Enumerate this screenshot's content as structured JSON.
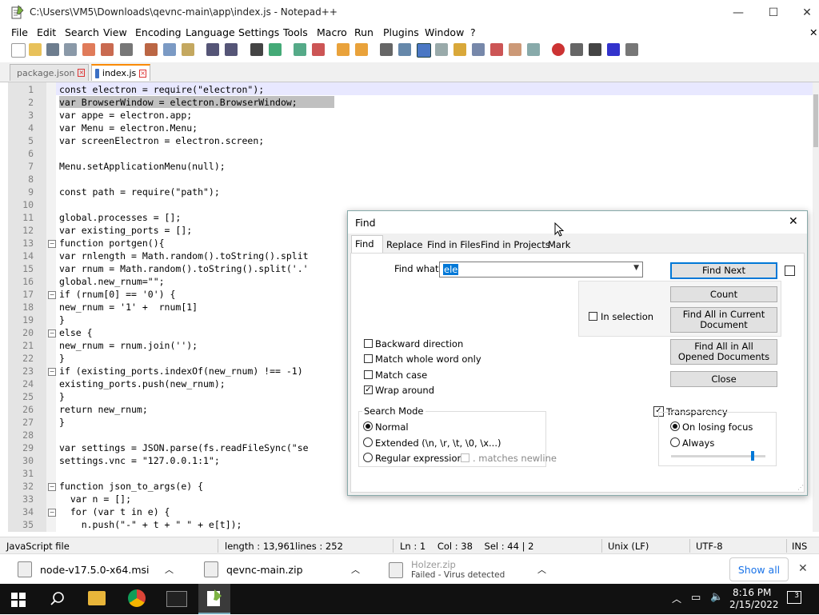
{
  "window": {
    "title": "C:\\Users\\VM5\\Downloads\\qevnc-main\\app\\index.js - Notepad++",
    "minimize": "—",
    "maximize": "☐",
    "close": "✕"
  },
  "menu": [
    "File",
    "Edit",
    "Search",
    "View",
    "Encoding",
    "Language",
    "Settings",
    "Tools",
    "Macro",
    "Run",
    "Plugins",
    "Window",
    "?"
  ],
  "menu_close": "✕",
  "tabs": [
    {
      "label": "package.json",
      "active": false
    },
    {
      "label": "index.js",
      "active": true
    }
  ],
  "editor": {
    "lines": [
      {
        "n": "1",
        "t": "const electron = require(\"electron\");"
      },
      {
        "n": "2",
        "t": "var BrowserWindow = electron.BrowserWindow;"
      },
      {
        "n": "3",
        "t": "var appe = electron.app;"
      },
      {
        "n": "4",
        "t": "var Menu = electron.Menu;"
      },
      {
        "n": "5",
        "t": "var screenElectron = electron.screen;"
      },
      {
        "n": "6",
        "t": ""
      },
      {
        "n": "7",
        "t": "Menu.setApplicationMenu(null);"
      },
      {
        "n": "8",
        "t": ""
      },
      {
        "n": "9",
        "t": "const path = require(\"path\");"
      },
      {
        "n": "10",
        "t": ""
      },
      {
        "n": "11",
        "t": "global.processes = [];"
      },
      {
        "n": "12",
        "t": "var existing_ports = [];"
      },
      {
        "n": "13",
        "t": "function portgen(){"
      },
      {
        "n": "14",
        "t": "var rnlength = Math.random().toString().split"
      },
      {
        "n": "15",
        "t": "var rnum = Math.random().toString().split('.'"
      },
      {
        "n": "16",
        "t": "global.new_rnum=\"\";"
      },
      {
        "n": "17",
        "t": "if (rnum[0] == '0') {"
      },
      {
        "n": "18",
        "t": "new_rnum = '1' +  rnum[1]"
      },
      {
        "n": "19",
        "t": "}"
      },
      {
        "n": "20",
        "t": "else {"
      },
      {
        "n": "21",
        "t": "new_rnum = rnum.join('');"
      },
      {
        "n": "22",
        "t": "}"
      },
      {
        "n": "23",
        "t": "if (existing_ports.indexOf(new_rnum) !== -1)"
      },
      {
        "n": "24",
        "t": "existing_ports.push(new_rnum);"
      },
      {
        "n": "25",
        "t": "}"
      },
      {
        "n": "26",
        "t": "return new_rnum;"
      },
      {
        "n": "27",
        "t": "}"
      },
      {
        "n": "28",
        "t": ""
      },
      {
        "n": "29",
        "t": "var settings = JSON.parse(fs.readFileSync(\"se"
      },
      {
        "n": "30",
        "t": "settings.vnc = \"127.0.0.1:1\";"
      },
      {
        "n": "31",
        "t": ""
      },
      {
        "n": "32",
        "t": "function json_to_args(e) {"
      },
      {
        "n": "33",
        "t": "  var n = [];"
      },
      {
        "n": "34",
        "t": "  for (var t in e) {"
      },
      {
        "n": "35",
        "t": "    n.push(\"-\" + t + \" \" + e[t]);"
      }
    ]
  },
  "status": {
    "file_type": "JavaScript file",
    "length": "length : 13,961",
    "lines": "lines : 252",
    "position": "Ln : 1    Col : 38    Sel : 44 | 2",
    "eol": "Unix (LF)",
    "encoding": "UTF-8",
    "mode": "INS"
  },
  "downloads": [
    {
      "name": "node-v17.5.0-x64.msi",
      "sub": ""
    },
    {
      "name": "qevnc-main.zip",
      "sub": ""
    },
    {
      "name": "Holzer.zip",
      "sub": "Failed - Virus detected"
    }
  ],
  "downloads_show_all": "Show all",
  "downloads_close": "✕",
  "taskbar": {
    "time": "8:16 PM",
    "date": "2/15/2022",
    "notif_count": "3"
  },
  "find_dialog": {
    "title": "Find",
    "close": "✕",
    "tabs": [
      "Find",
      "Replace",
      "Find in Files",
      "Find in Projects",
      "Mark"
    ],
    "find_what_label": "Find what :",
    "find_what_value": "ele",
    "buttons": {
      "find_next": "Find Next",
      "count": "Count",
      "find_all_current": "Find All in Current Document",
      "find_all_opened": "Find All in All Opened Documents",
      "close": "Close"
    },
    "in_selection": "In selection",
    "options": [
      {
        "label": "Backward direction",
        "checked": false
      },
      {
        "label": "Match whole word only",
        "checked": false
      },
      {
        "label": "Match case",
        "checked": false
      },
      {
        "label": "Wrap around",
        "checked": true
      }
    ],
    "search_mode_label": "Search Mode",
    "modes": [
      {
        "label": "Normal",
        "on": true
      },
      {
        "label": "Extended (\\n, \\r, \\t, \\0, \\x...)",
        "on": false
      },
      {
        "label": "Regular expression",
        "on": false
      }
    ],
    "matches_newline": ". matches newline",
    "transparency_label": "Transparency",
    "transparency_checked": true,
    "transparency_modes": [
      {
        "label": "On losing focus",
        "on": true
      },
      {
        "label": "Always",
        "on": false
      }
    ],
    "transparency_level": 0.85
  }
}
